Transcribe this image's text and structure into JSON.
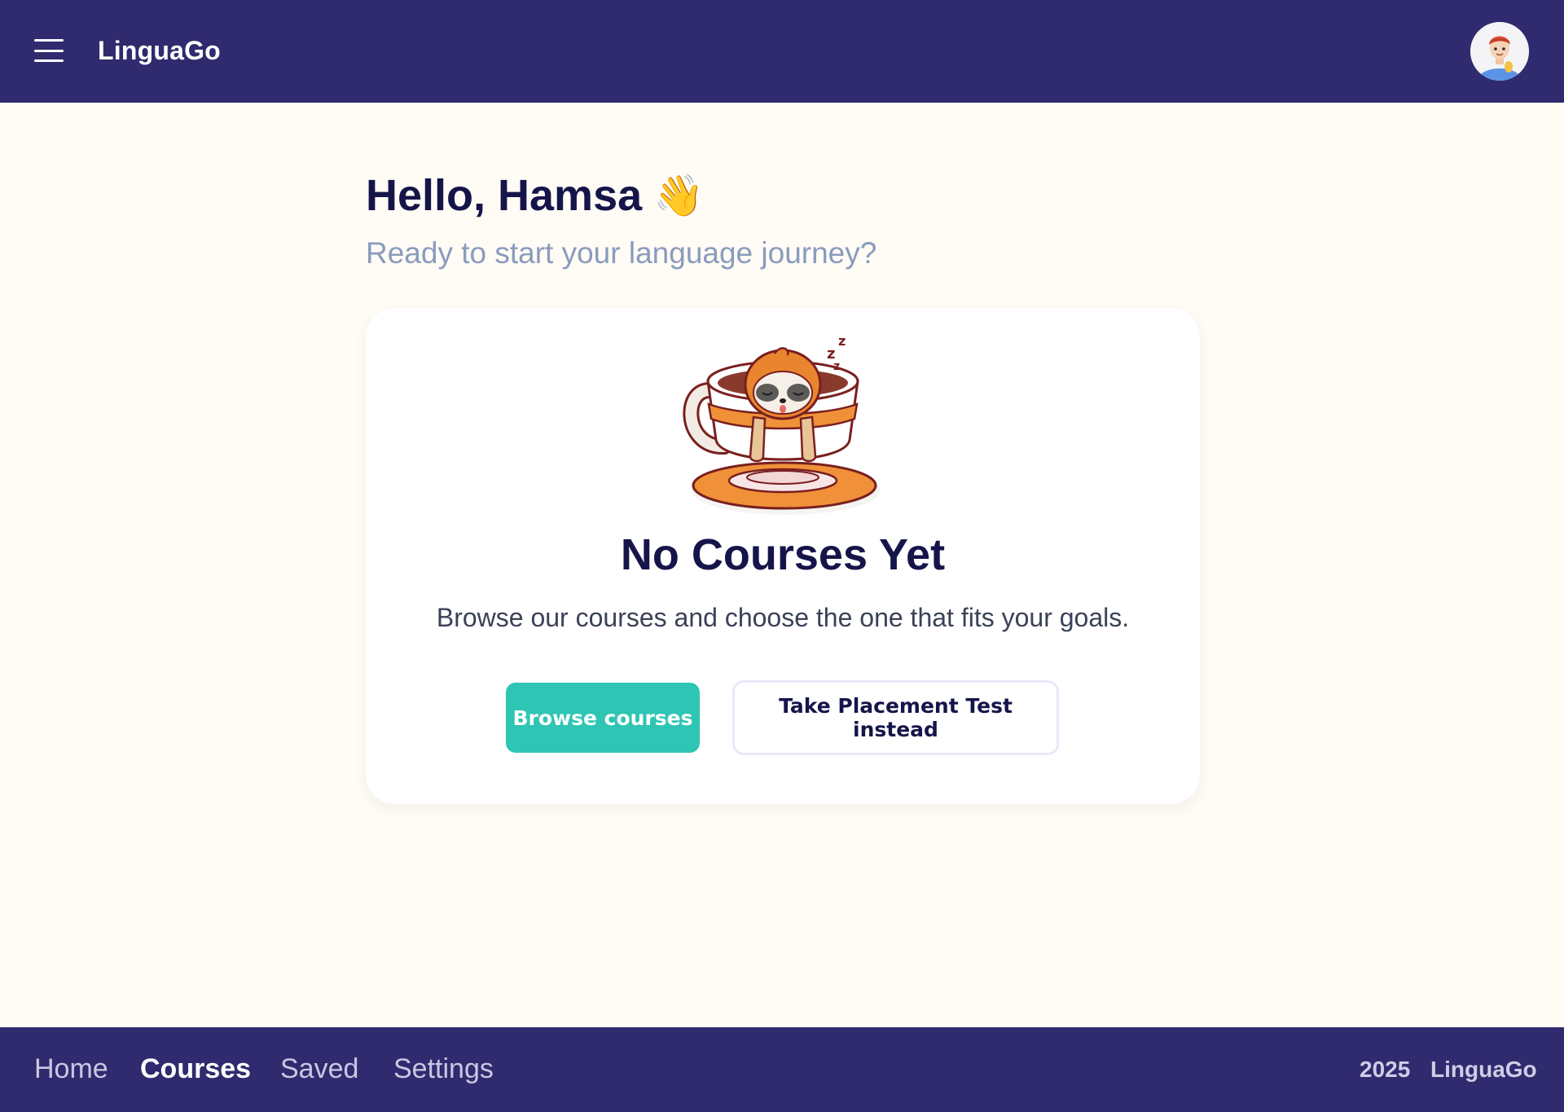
{
  "app": {
    "brand": "LinguaGo"
  },
  "header": {
    "menu_icon": "hamburger-menu-icon",
    "avatar_icon": "user-avatar"
  },
  "main": {
    "greeting": "Hello, Hamsa",
    "greeting_emoji": "👋",
    "subtitle": "Ready to start your language journey?"
  },
  "empty_state": {
    "illustration": "sleeping-sloth-in-cup",
    "title": "No Courses Yet",
    "description": "Browse our courses and choose the one that fits your goals.",
    "primary_label": "Browse courses",
    "secondary_label": "Take Placement Test instead"
  },
  "footer": {
    "nav": [
      {
        "label": "Home",
        "active": false
      },
      {
        "label": "Courses",
        "active": true
      },
      {
        "label": "Saved",
        "active": false
      },
      {
        "label": "Settings",
        "active": false
      }
    ],
    "year": "2025",
    "brand": "LinguaGo"
  },
  "colors": {
    "header_bg": "#302a6e",
    "page_bg": "#fffbf5",
    "primary": "#2ec5b4",
    "heading": "#15154a",
    "subtitle": "#8a9bbd",
    "card_bg": "#ffffff"
  }
}
